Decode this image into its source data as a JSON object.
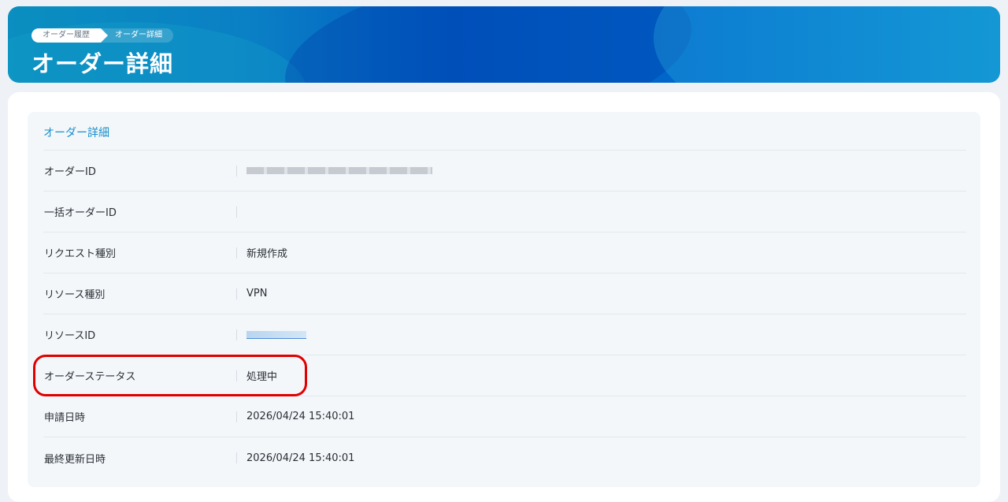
{
  "breadcrumb": {
    "items": [
      "オーダー履歴",
      "オーダー詳細"
    ]
  },
  "header": {
    "title": "オーダー詳細"
  },
  "section": {
    "title": "オーダー詳細"
  },
  "fields": [
    {
      "label": "オーダーID",
      "value": "",
      "redacted": true
    },
    {
      "label": "一括オーダーID",
      "value": ""
    },
    {
      "label": "リクエスト種別",
      "value": "新規作成"
    },
    {
      "label": "リソース種別",
      "value": "VPN"
    },
    {
      "label": "リソースID",
      "value": "",
      "redacted_link": true
    },
    {
      "label": "オーダーステータス",
      "value": "処理中"
    },
    {
      "label": "申請日時",
      "value": "2026/04/24 15:40:01"
    },
    {
      "label": "最終更新日時",
      "value": "2026/04/24 15:40:01"
    }
  ],
  "colors": {
    "accent": "#1a8fcc",
    "highlight": "#e00000",
    "banner_start": "#0a8fc0",
    "banner_mid": "#0059c2"
  }
}
